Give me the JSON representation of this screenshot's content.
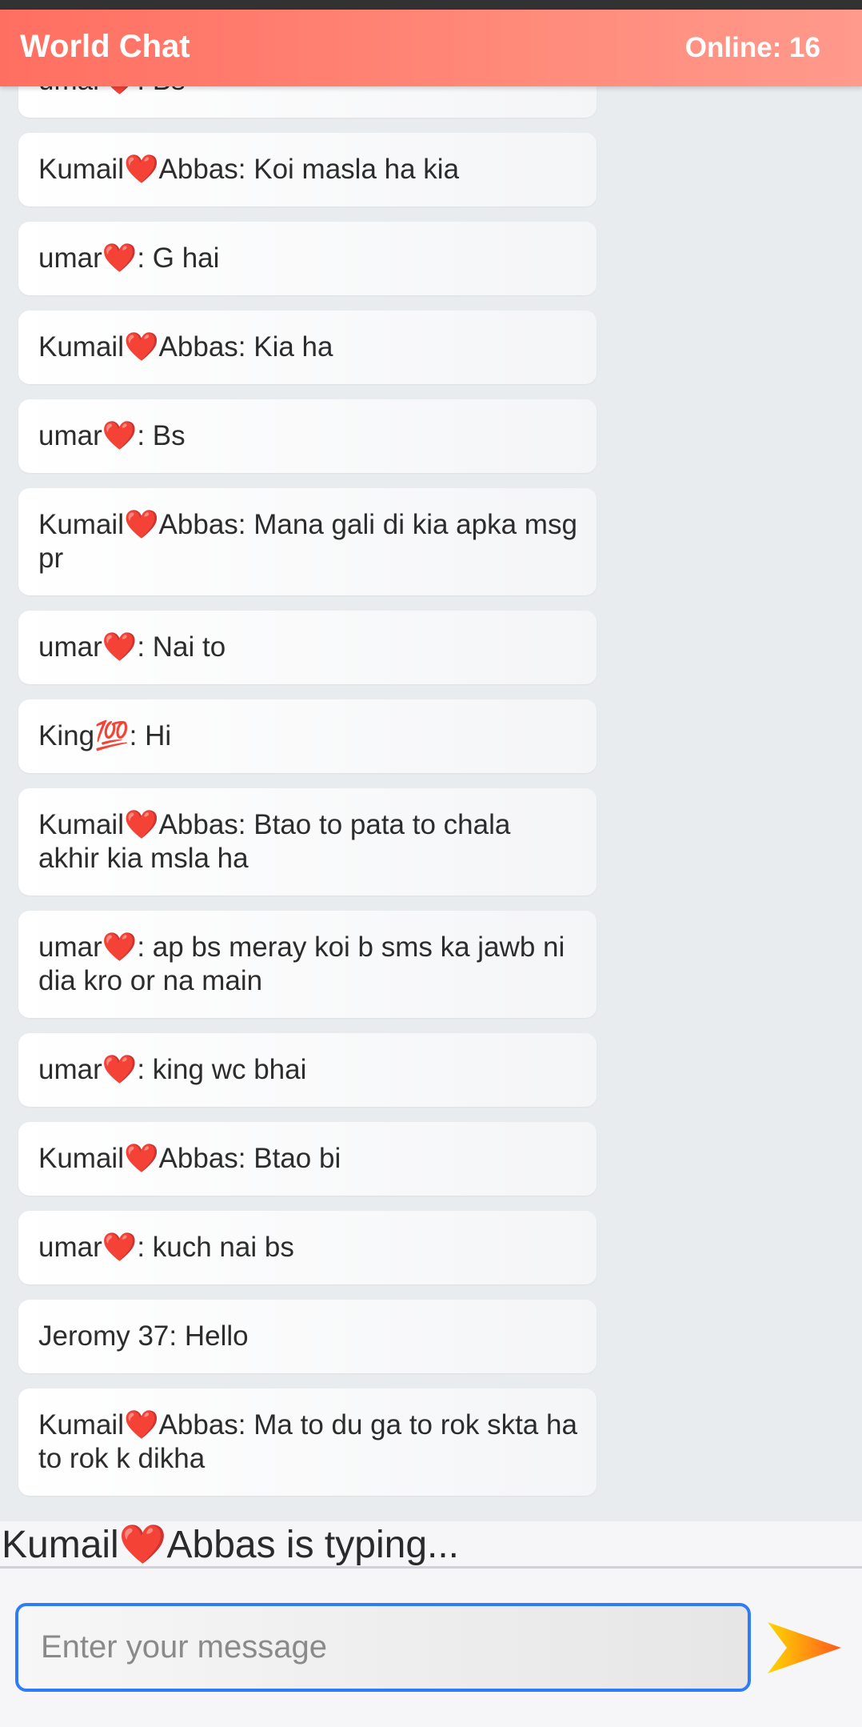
{
  "header": {
    "title": "World Chat",
    "online_label": "Online: 16"
  },
  "messages": [
    "umar❤️: Bs",
    "Kumail❤️Abbas: Koi masla ha kia",
    "umar❤️: G hai",
    "Kumail❤️Abbas: Kia ha",
    "umar❤️: Bs",
    "Kumail❤️Abbas: Mana gali di kia apka msg pr",
    "umar❤️: Nai to",
    "King💯: Hi",
    "Kumail❤️Abbas: Btao to pata to chala akhir kia msla ha",
    "umar❤️: ap bs meray koi b sms ka jawb ni dia kro or na main",
    "umar❤️: king wc bhai",
    "Kumail❤️Abbas: Btao bi",
    "umar❤️: kuch nai bs",
    "Jeromy 37: Hello",
    "Kumail❤️Abbas: Ma to du ga to rok skta ha to rok k dikha"
  ],
  "typing_indicator": "Kumail❤️Abbas is typing...",
  "composer": {
    "placeholder": "Enter your message",
    "value": ""
  },
  "icons": {
    "send": "send-arrow-icon"
  },
  "colors": {
    "header_start": "#ff6f61",
    "header_end": "#ff9a8c",
    "input_border": "#2f7df6",
    "send_arrow_start": "#ffd600",
    "send_arrow_end": "#ff5a1f"
  }
}
